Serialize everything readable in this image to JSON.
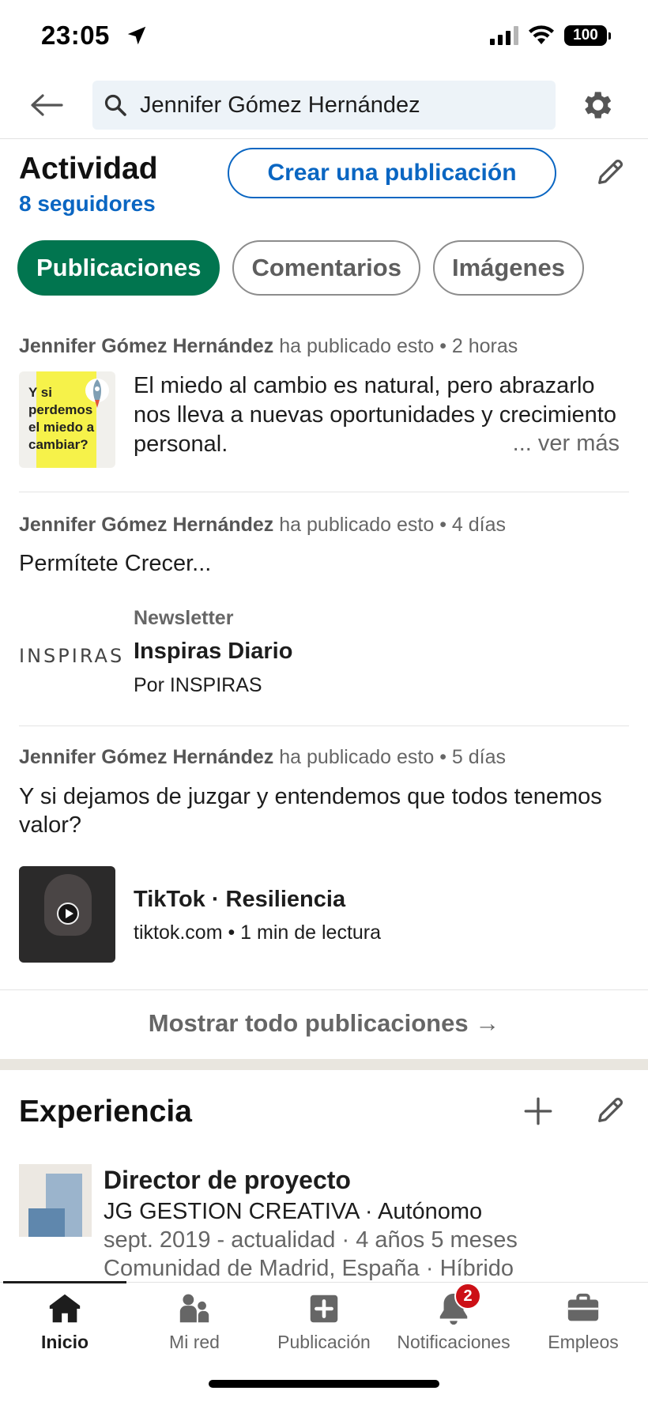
{
  "status_bar": {
    "time": "23:05",
    "battery": "100"
  },
  "search": {
    "query": "Jennifer Gómez Hernández"
  },
  "activity": {
    "title": "Actividad",
    "followers": "8 seguidores",
    "create_post_label": "Crear una publicación",
    "tabs": [
      {
        "label": "Publicaciones",
        "active": true
      },
      {
        "label": "Comentarios",
        "active": false
      },
      {
        "label": "Imágenes",
        "active": false
      }
    ]
  },
  "posts": [
    {
      "author": "Jennifer Gómez Hernández",
      "action": "ha publicado esto • 2 horas",
      "thumb_text": "Y si perdemos el miedo a cambiar?",
      "text": "El miedo al cambio es natural, pero abrazarlo nos lleva a nuevas oportunidades y crecimiento personal.",
      "see_more": "... ver más"
    },
    {
      "author": "Jennifer Gómez Hernández",
      "action": "ha publicado esto • 4 días",
      "title": "Permítete Crecer...",
      "logo_text": "INSPIRAS",
      "newsletter_label": "Newsletter",
      "newsletter_name": "Inspiras Diario",
      "newsletter_by": "Por INSPIRAS"
    },
    {
      "author": "Jennifer Gómez Hernández",
      "action": "ha publicado esto • 5 días",
      "title": "Y si dejamos de juzgar y entendemos que todos tenemos valor?",
      "link_title": "TikTok · Resiliencia",
      "link_source": "tiktok.com • 1 min de lectura"
    }
  ],
  "show_all": "Mostrar todo publicaciones →",
  "experience": {
    "title": "Experiencia",
    "job_title": "Director de proyecto",
    "company": "JG GESTION CREATIVA · Autónomo",
    "dates": "sept. 2019 - actualidad · 4 años 5 meses",
    "location": "Comunidad de Madrid, España · Híbrido"
  },
  "nav": {
    "items": [
      {
        "label": "Inicio",
        "icon": "home-icon",
        "active": true
      },
      {
        "label": "Mi red",
        "icon": "network-icon",
        "active": false
      },
      {
        "label": "Publicación",
        "icon": "post-icon",
        "active": false
      },
      {
        "label": "Notificaciones",
        "icon": "bell-icon",
        "active": false,
        "badge": "2"
      },
      {
        "label": "Empleos",
        "icon": "briefcase-icon",
        "active": false
      }
    ]
  },
  "colors": {
    "accent": "#0a66c2",
    "active_chip": "#01754f",
    "badge": "#cc1016"
  }
}
